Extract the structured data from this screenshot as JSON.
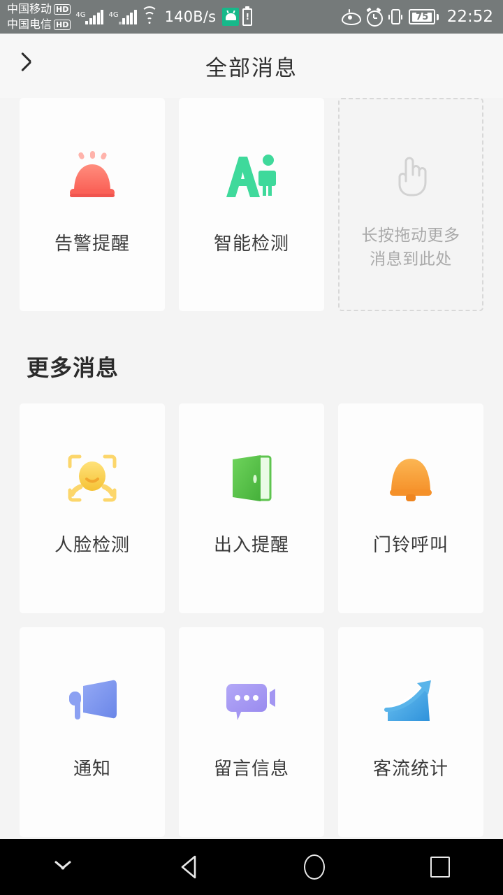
{
  "statusbar": {
    "carrier_1": "中国移动",
    "carrier_1_badge": "HD",
    "carrier_2": "中国电信",
    "carrier_2_badge": "HD",
    "network_type_1": "4G",
    "network_type_2": "4G",
    "net_speed": "140B/s",
    "battery_level": "75",
    "battery_warning": "!",
    "clock": "22:52",
    "icons": [
      "wifi-icon",
      "android-robot-icon",
      "battery-warning-icon",
      "eye-comfort-icon",
      "alarm-clock-icon",
      "vibrate-icon",
      "battery-icon"
    ],
    "bg_color": "#757a7a"
  },
  "header": {
    "title": "全部消息",
    "back_icon": "chevron-left-icon"
  },
  "top_section": {
    "cards": [
      {
        "label": "告警提醒",
        "icon": "alarm-siren-icon",
        "color": "#fa7268"
      },
      {
        "label": "智能检测",
        "icon": "ai-person-icon",
        "color": "#3fd99b"
      }
    ],
    "dropzone": {
      "icon": "pointing-hand-icon",
      "text_line_1": "长按拖动更多",
      "text_line_2": "消息到此处",
      "border_color": "#d8d8d8"
    }
  },
  "more_section": {
    "title": "更多消息",
    "cards": [
      {
        "label": "人脸检测",
        "icon": "face-detect-icon",
        "color": "#f7cf52"
      },
      {
        "label": "出入提醒",
        "icon": "open-door-icon",
        "color": "#57c24a"
      },
      {
        "label": "门铃呼叫",
        "icon": "doorbell-bell-icon",
        "color": "#f7a13a"
      },
      {
        "label": "通知",
        "icon": "megaphone-icon",
        "color": "#7b96ef"
      },
      {
        "label": "留言信息",
        "icon": "chat-bubble-dots-icon",
        "color": "#a59bf0"
      },
      {
        "label": "客流统计",
        "icon": "trend-up-chart-icon",
        "color": "#4ba9e8"
      }
    ]
  },
  "navbar": {
    "items": [
      {
        "icon": "chevron-down-icon",
        "name": "hide-navbar"
      },
      {
        "icon": "back-triangle-icon",
        "name": "back"
      },
      {
        "icon": "home-circle-icon",
        "name": "home"
      },
      {
        "icon": "recents-square-icon",
        "name": "recents"
      }
    ],
    "bg_color": "#000000"
  },
  "theme": {
    "page_bg": "#f4f4f4",
    "card_bg": "#fdfdfd",
    "title_bg": "#f7f7f7",
    "text_primary": "#3a3a3a",
    "text_muted": "#a9a9a9"
  }
}
